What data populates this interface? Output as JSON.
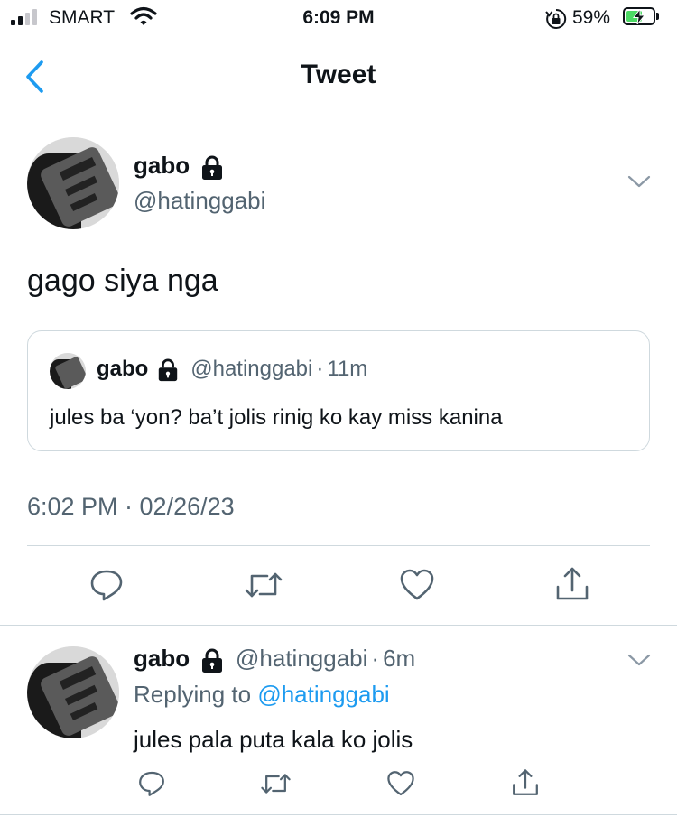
{
  "status_bar": {
    "carrier": "SMART",
    "time": "6:09 PM",
    "battery_percent": "59%",
    "battery_level": 0.59,
    "icons": [
      "signal-icon",
      "wifi-icon",
      "orientation-lock-icon",
      "battery-charging-icon"
    ]
  },
  "nav": {
    "title": "Tweet",
    "back_icon": "chevron-left-icon"
  },
  "main_tweet": {
    "author_name": "gabo",
    "handle": "@hatinggabi",
    "text": "gago siya nga",
    "quoted": {
      "author_name": "gabo",
      "handle": "@hatinggabi",
      "separator": "·",
      "time_ago": "11m",
      "text": "jules ba ‘yon? ba’t jolis rinig ko kay miss kanina"
    },
    "timestamp": "6:02 PM · 02/26/23",
    "actions": [
      "reply-icon",
      "retweet-icon",
      "like-icon",
      "share-icon"
    ]
  },
  "reply": {
    "author_name": "gabo",
    "handle": "@hatinggabi",
    "separator": "·",
    "time_ago": "6m",
    "replying_prefix": "Replying to",
    "replying_to": "@hatinggabi",
    "text": "jules pala puta kala ko jolis",
    "actions": [
      "reply-icon",
      "retweet-icon",
      "like-icon",
      "share-icon"
    ]
  },
  "colors": {
    "accent": "#1d9bf0",
    "text": "#0f1419",
    "muted": "#536471",
    "border": "#cfd9de",
    "battery": "#4cd964"
  }
}
